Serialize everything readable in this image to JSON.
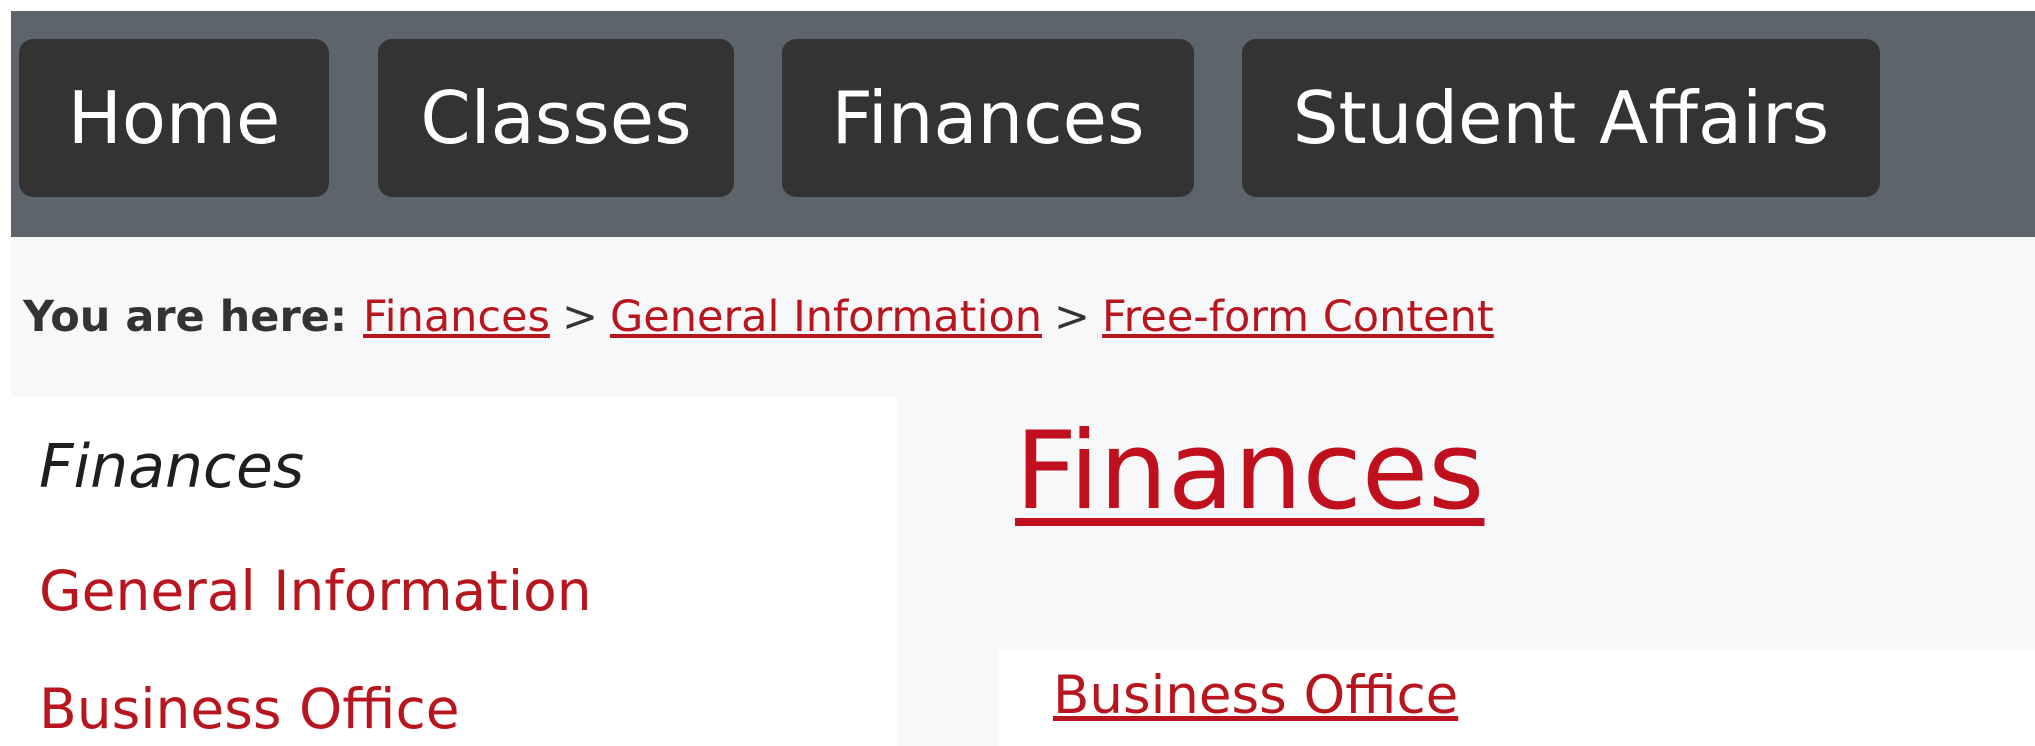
{
  "nav": {
    "items": [
      {
        "label": "Home"
      },
      {
        "label": "Classes"
      },
      {
        "label": "Finances"
      },
      {
        "label": "Student Affairs"
      }
    ]
  },
  "breadcrumb": {
    "prefix": "You are here:",
    "separator": ">",
    "items": [
      {
        "label": "Finances"
      },
      {
        "label": "General Information"
      },
      {
        "label": "Free-form Content"
      }
    ]
  },
  "sidebar": {
    "title": "Finances",
    "items": [
      {
        "label": "General Information"
      },
      {
        "label": "Business Office"
      }
    ]
  },
  "main": {
    "title": "Finances",
    "links": [
      {
        "label": "Business Office"
      }
    ]
  },
  "colors": {
    "nav_background": "#5d646b",
    "nav_button": "#333333",
    "link": "#b8161f",
    "page_background": "#f7f8fa"
  }
}
